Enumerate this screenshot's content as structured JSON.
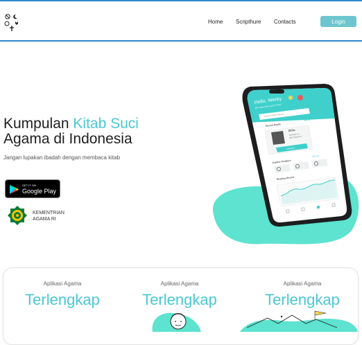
{
  "header": {
    "nav": [
      {
        "label": "Home"
      },
      {
        "label": "Scripthure"
      },
      {
        "label": "Contacts"
      }
    ],
    "login_label": "Login",
    "accent_color": "#2a89d0",
    "button_color": "#6dc6cf"
  },
  "hero": {
    "title_part1": "Kumpulan ",
    "title_accent": "Kitab Suci",
    "title_line2": "Agama di Indonesia",
    "subtitle": "Jangan lupakan ibadah dengan membaca kitab",
    "accent_color": "#49c8d3"
  },
  "store_badge": {
    "small": "GET IT ON",
    "big": "Google Play"
  },
  "ministry": {
    "line1": "KEMENTRIAN",
    "line2": "AGAMA RI"
  },
  "phone_screen": {
    "greeting": "Hello, Werky",
    "greeting_sub": "let's read some word of God",
    "search_placeholder": "Search Some Verses",
    "recent_title": "Recent Reads",
    "see_all": "See All",
    "book_title": "Biblia",
    "book_line1": "Genesis 1:1",
    "book_line2": "Old Testament",
    "continue": "Continue",
    "explore_title": "Explore Scripture",
    "reading_title": "Reading Record",
    "days": [
      "S",
      "M",
      "T",
      "W",
      "T",
      "F",
      "S"
    ]
  },
  "cards": [
    {
      "label": "Aplikasi Agama",
      "big": "Terlengkap"
    },
    {
      "label": "Aplikasi Agama",
      "big": "Terlengkap"
    },
    {
      "label": "Aplikasi Agama",
      "big": "Terlengkap"
    }
  ]
}
